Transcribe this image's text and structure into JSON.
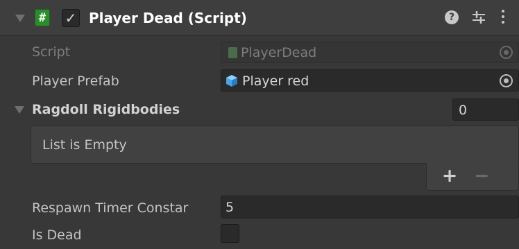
{
  "component": {
    "title": "Player Dead (Script)",
    "enabled": true,
    "icons": {
      "fold": "triangle-down-icon",
      "script": "hash-icon",
      "help": "question-icon",
      "presets": "sliders-icon",
      "menu": "kebab-icon"
    },
    "help_glyph": "?",
    "script_glyph": "#",
    "check_glyph": "✓"
  },
  "fields": {
    "script": {
      "label": "Script",
      "value": "PlayerDead"
    },
    "player_prefab": {
      "label": "Player Prefab",
      "value": "Player red"
    },
    "ragdoll": {
      "label": "Ragdoll Rigidbodies",
      "size": "0",
      "empty_text": "List is Empty",
      "add_glyph": "+",
      "remove_glyph": "−"
    },
    "respawn": {
      "label": "Respawn Timer Constar",
      "value": "5"
    },
    "is_dead": {
      "label": "Is Dead",
      "checked": false
    }
  },
  "colors": {
    "background": "#383838",
    "header": "#3e3e3e",
    "field": "#2a2a2a",
    "script_badge": "#2f8a2f",
    "prefab_icon": "#4aa3e8"
  }
}
